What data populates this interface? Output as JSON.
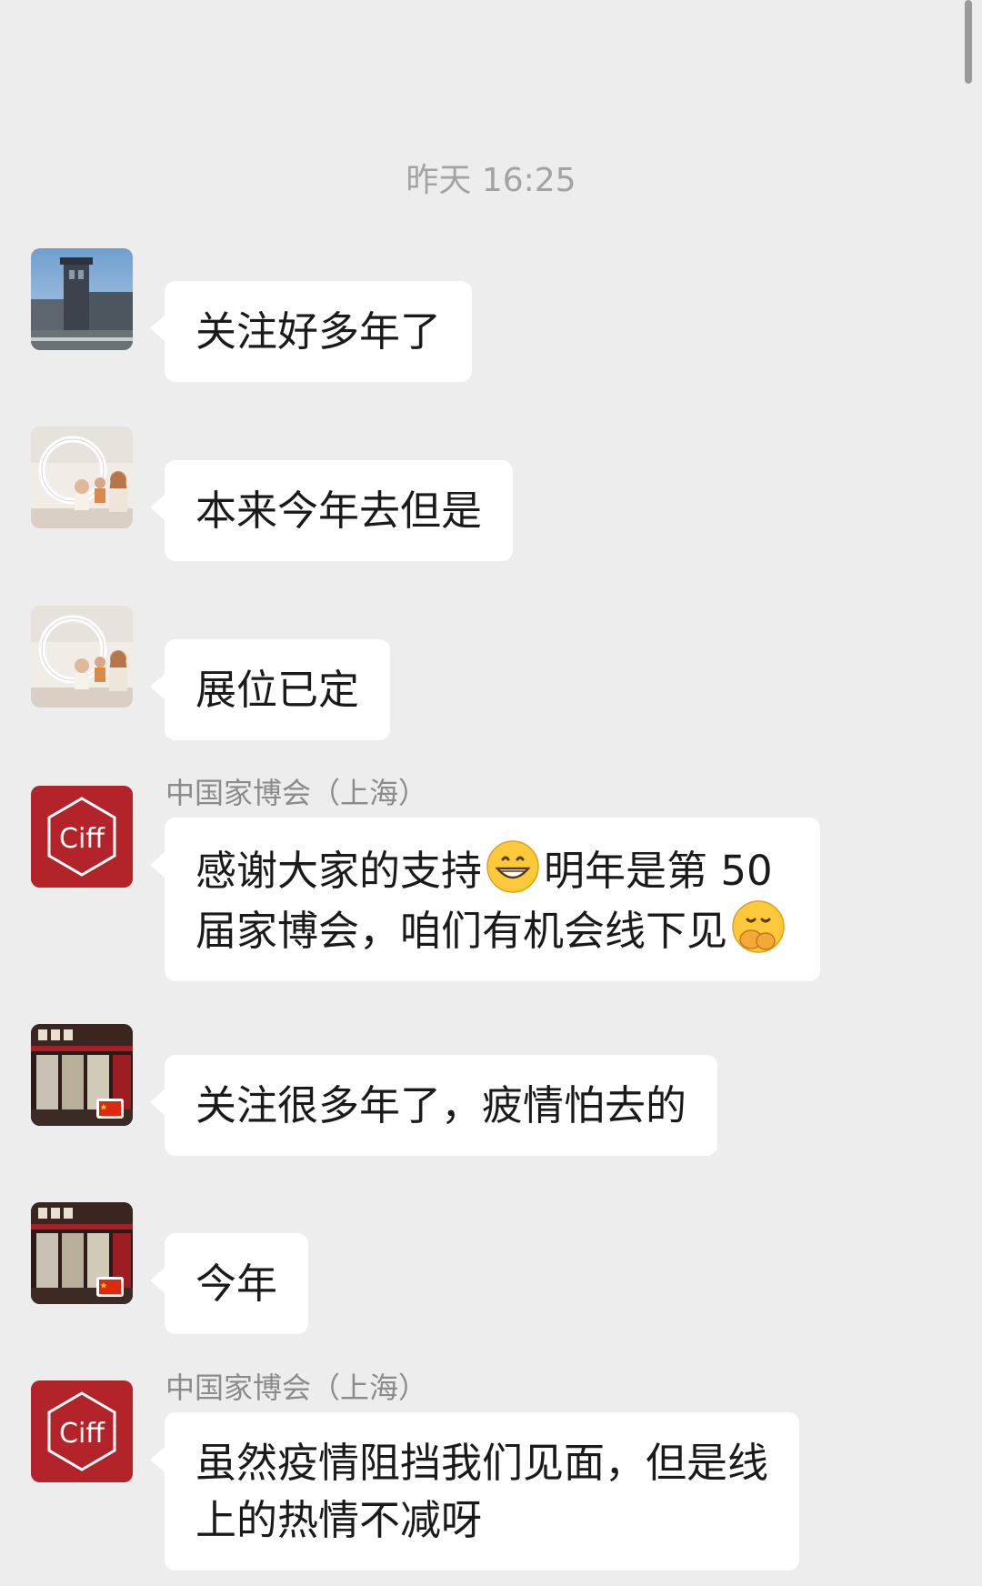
{
  "timestamp": "昨天 16:25",
  "messages": [
    {
      "text": "关注好多年了"
    },
    {
      "text": "本来今年去但是"
    },
    {
      "text": "展位已定"
    },
    {
      "sender": "中国家博会（上海）",
      "line1_a": "感谢大家的支持",
      "emoji1": "grinning-emoji",
      "line1_b": "明年是第 50",
      "line2": "届家博会，咱们有机会线下见",
      "emoji2": "shushing-face-emoji"
    },
    {
      "text": "关注很多年了，疲情怕去的"
    },
    {
      "text": "今年"
    },
    {
      "sender": "中国家博会（上海）",
      "line1": "虽然疫情阻挡我们见面，但是线",
      "line2": "上的热情不减呀"
    }
  ],
  "logo_text": "Ciff",
  "colors": {
    "background": "#ededed",
    "bubble": "#ffffff",
    "ciff_red": "#b3242a"
  }
}
